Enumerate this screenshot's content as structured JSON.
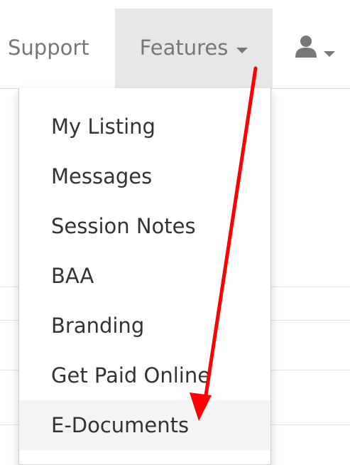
{
  "nav": {
    "support_label": "Support",
    "features_label": "Features",
    "user_icon": "user-icon"
  },
  "dropdown": {
    "items": [
      {
        "label": "My Listing"
      },
      {
        "label": "Messages"
      },
      {
        "label": "Session Notes"
      },
      {
        "label": "BAA"
      },
      {
        "label": "Branding"
      },
      {
        "label": "Get Paid Online"
      },
      {
        "label": "E-Documents",
        "highlighted": true
      }
    ]
  },
  "colors": {
    "annotation_arrow": "#ff0000",
    "nav_active_bg": "#e7e7e7",
    "nav_text": "#777777",
    "menu_text": "#333333"
  }
}
